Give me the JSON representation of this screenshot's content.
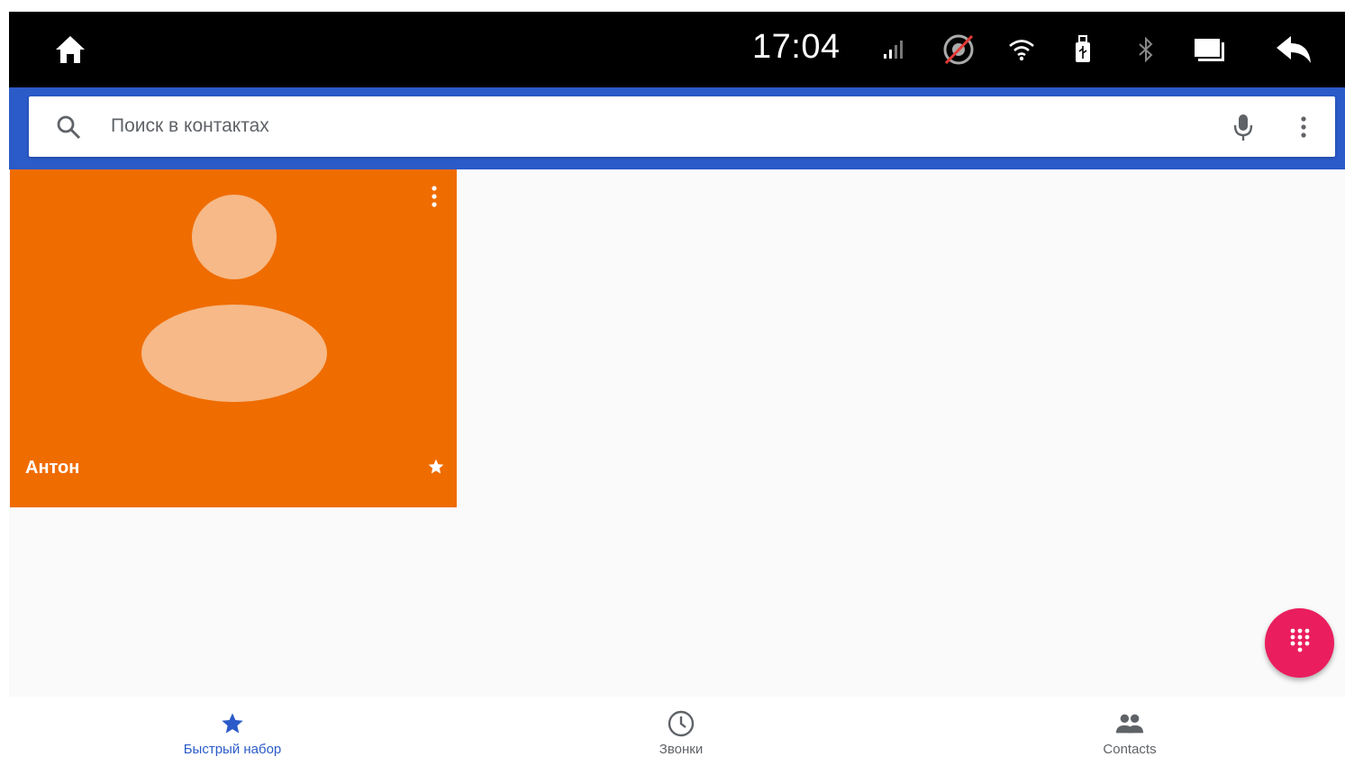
{
  "statusbar": {
    "time": "17:04",
    "icons": [
      "home-icon",
      "signal-icon",
      "gps-off-icon",
      "wifi-icon",
      "usb-icon",
      "bluetooth-icon",
      "screen-icon",
      "back-icon"
    ]
  },
  "search": {
    "placeholder": "Поиск в контактах",
    "icons": [
      "search-icon",
      "mic-icon",
      "more-vert-icon"
    ]
  },
  "favorites": [
    {
      "name": "Антон",
      "starred": true,
      "color": "#ef6c00"
    }
  ],
  "fab": {
    "icon": "dialpad-icon",
    "color": "#ea1e5e"
  },
  "bottom_nav": [
    {
      "label": "Быстрый набор",
      "icon": "star-icon",
      "active": true
    },
    {
      "label": "Звонки",
      "icon": "clock-icon",
      "active": false
    },
    {
      "label": "Contacts",
      "icon": "people-icon",
      "active": false
    }
  ],
  "colors": {
    "accent": "#2b5bc8",
    "tile": "#ef6c00",
    "fab": "#ea1e5e"
  }
}
